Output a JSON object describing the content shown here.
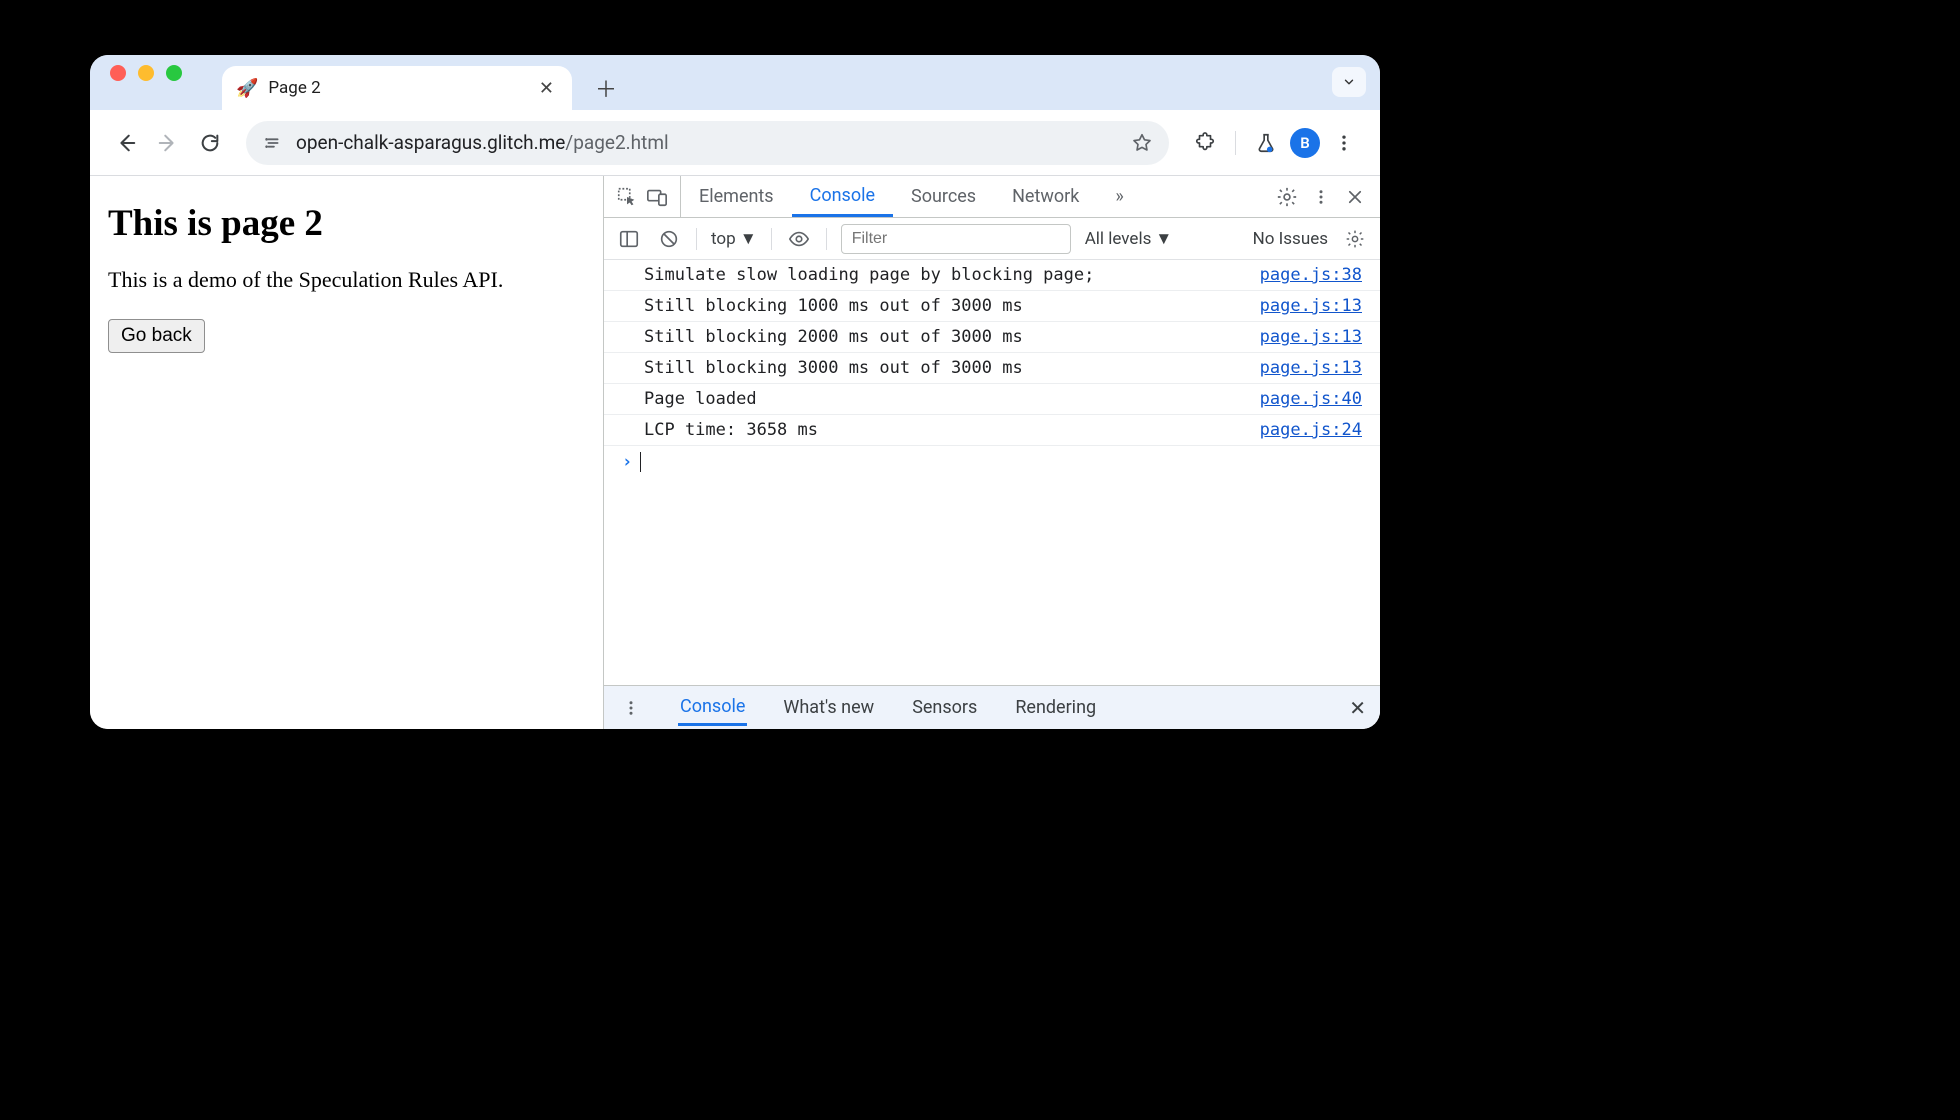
{
  "tab": {
    "favicon": "🚀",
    "title": "Page 2"
  },
  "omnibox": {
    "domain": "open-chalk-asparagus.glitch.me",
    "path": "/page2.html"
  },
  "avatar_letter": "B",
  "page": {
    "heading": "This is page 2",
    "text": "This is a demo of the Speculation Rules API.",
    "button": "Go back"
  },
  "devtools": {
    "tabs": [
      "Elements",
      "Console",
      "Sources",
      "Network"
    ],
    "active_tab": "Console",
    "more": "»",
    "context": "top",
    "filter_placeholder": "Filter",
    "levels": "All levels",
    "issues": "No Issues",
    "logs": [
      {
        "msg": "Simulate slow loading page by blocking page;",
        "src": "page.js:38"
      },
      {
        "msg": "Still blocking 1000 ms out of 3000 ms",
        "src": "page.js:13"
      },
      {
        "msg": "Still blocking 2000 ms out of 3000 ms",
        "src": "page.js:13"
      },
      {
        "msg": "Still blocking 3000 ms out of 3000 ms",
        "src": "page.js:13"
      },
      {
        "msg": "Page loaded",
        "src": "page.js:40"
      },
      {
        "msg": "LCP time: 3658 ms",
        "src": "page.js:24"
      }
    ],
    "drawer_tabs": [
      "Console",
      "What's new",
      "Sensors",
      "Rendering"
    ],
    "drawer_active": "Console"
  }
}
